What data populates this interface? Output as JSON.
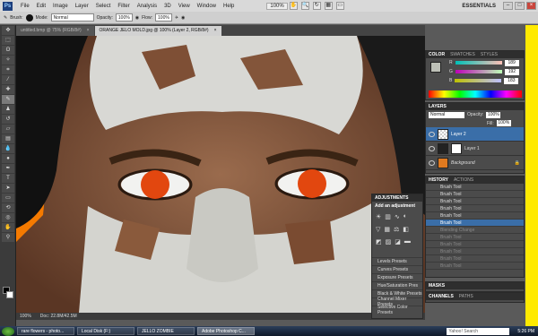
{
  "menubar": {
    "logo": "Ps",
    "items": [
      "File",
      "Edit",
      "Image",
      "Layer",
      "Select",
      "Filter",
      "Analysis",
      "3D",
      "View",
      "Window",
      "Help"
    ],
    "zoom": "100%",
    "workspace": "ESSENTIALS"
  },
  "options": {
    "brush_label": "Brush:",
    "mode_label": "Mode:",
    "mode_value": "Normal",
    "opacity_label": "Opacity:",
    "opacity_value": "100%",
    "flow_label": "Flow:",
    "flow_value": "100%"
  },
  "documents": {
    "tabs": [
      {
        "label": "untitled.bmp @ 75% (RGB/8#)",
        "active": false
      },
      {
        "label": "ORANGE JELO MOLD.jpg @ 100% (Layer 2, RGB/8#)",
        "active": true
      }
    ],
    "close_glyph": "×"
  },
  "status": {
    "zoom": "100%",
    "doc": "Doc: 22.8M/42.5M"
  },
  "color_panel": {
    "tabs": [
      "COLOR",
      "SWATCHES",
      "STYLES"
    ],
    "channels": [
      {
        "label": "R",
        "value": "189"
      },
      {
        "label": "G",
        "value": "192"
      },
      {
        "label": "B",
        "value": "183"
      }
    ]
  },
  "layers_panel": {
    "tabs": [
      "LAYERS"
    ],
    "blend_mode": "Normal",
    "opacity_label": "Opacity:",
    "opacity_value": "100%",
    "fill_label": "Fill:",
    "fill_value": "100%",
    "layers": [
      {
        "name": "Layer 2",
        "selected": true
      },
      {
        "name": "Layer 1",
        "selected": false
      },
      {
        "name": "Background",
        "selected": false
      }
    ]
  },
  "history_panel": {
    "tabs": [
      "HISTORY",
      "ACTIONS"
    ],
    "items": [
      {
        "label": "Brush Tool",
        "state": "normal"
      },
      {
        "label": "Brush Tool",
        "state": "normal"
      },
      {
        "label": "Brush Tool",
        "state": "normal"
      },
      {
        "label": "Brush Tool",
        "state": "normal"
      },
      {
        "label": "Brush Tool",
        "state": "normal"
      },
      {
        "label": "Brush Tool",
        "state": "selected"
      },
      {
        "label": "Blending Change",
        "state": "dim"
      },
      {
        "label": "Brush Tool",
        "state": "dim"
      },
      {
        "label": "Brush Tool",
        "state": "dim"
      },
      {
        "label": "Brush Tool",
        "state": "dim"
      },
      {
        "label": "Brush Tool",
        "state": "dim"
      },
      {
        "label": "Brush Tool",
        "state": "dim"
      }
    ]
  },
  "masks_panel": {
    "label": "MASKS"
  },
  "channels_panel": {
    "tabs": [
      "CHANNELS",
      "PATHS"
    ]
  },
  "adjustments_panel": {
    "title": "ADJUSTMENTS",
    "subtitle": "Add an adjustment",
    "presets": [
      "Levels Presets",
      "Curves Presets",
      "Exposure Presets",
      "Hue/Saturation Pres",
      "Black & White Presets",
      "Channel Mixer Presets",
      "Selective Color Presets"
    ]
  },
  "taskbar": {
    "items": [
      {
        "label": "rare flowers - photo...",
        "active": false
      },
      {
        "label": "Local Disk (F:)",
        "active": false
      },
      {
        "label": "JELLO ZOMBIE",
        "active": false
      },
      {
        "label": "Adobe Photoshop C...",
        "active": true
      }
    ],
    "search_placeholder": "Yahoo! Search",
    "clock": "5:26 PM"
  },
  "colors": {
    "accent": "#3a6ea8",
    "eye_orange": "#e2470f",
    "background_orange": "#ff7a00"
  }
}
